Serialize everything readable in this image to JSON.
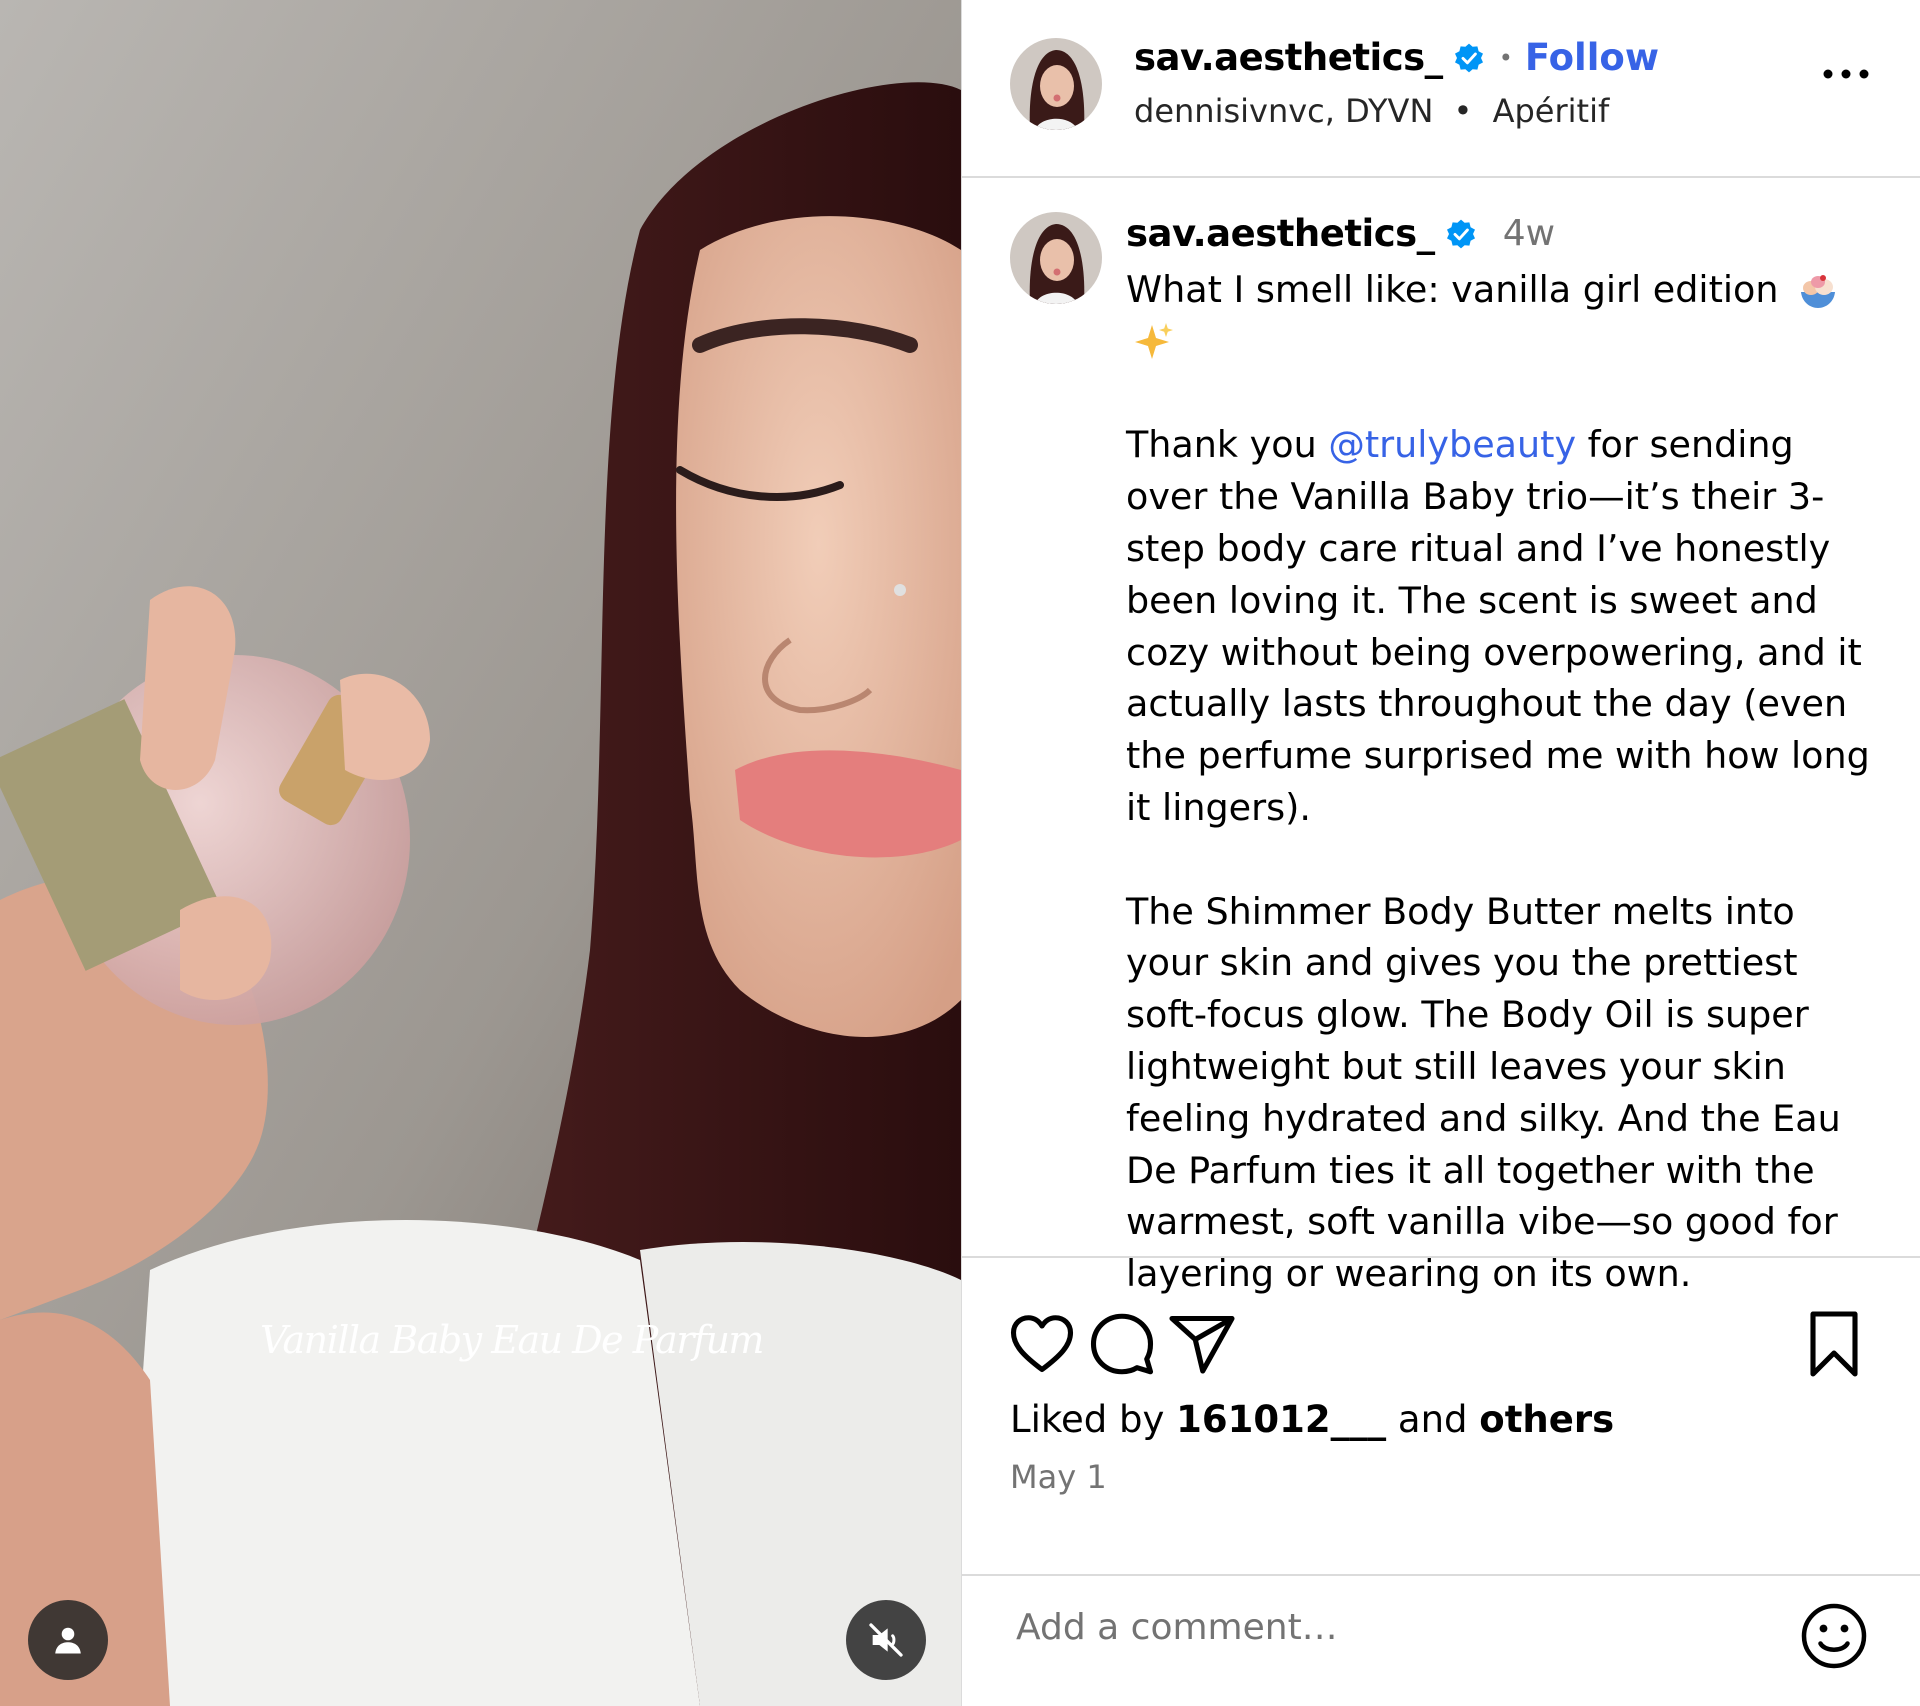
{
  "post": {
    "media": {
      "overlay_text": "Vanilla Baby Eau De Parfum",
      "tag_icon": "person-icon",
      "mute_icon": "speaker-muted-icon"
    },
    "header": {
      "username": "sav.aesthetics_",
      "verified": true,
      "separator": "•",
      "follow_label": "Follow",
      "audio_artists": "dennisivnvc, DYVN",
      "audio_separator": "•",
      "audio_title": "Apéritif",
      "more_icon": "more-horizontal-icon"
    },
    "caption": {
      "username": "sav.aesthetics_",
      "time": "4w",
      "first_line": "What I smell like: vanilla girl edition",
      "first_line_emojis": [
        "ice-cream-bowl-emoji",
        "sparkles-emoji"
      ],
      "para1_before": "Thank you ",
      "para1_mention": "@trulybeauty",
      "para1_after": " for sending over the Vanilla Baby trio—it’s their 3-step body care ritual and I’ve honestly been loving it. The scent is sweet and cozy without being overpowering, and it actually lasts throughout the day (even the perfume surprised me with how long it lingers).",
      "para2": "The Shimmer Body Butter melts into your skin and gives you the prettiest soft-focus glow. The Body Oil is super lightweight but still leaves your skin feeling hydrated and silky. And the Eau De Parfum ties it all together with the warmest, soft vanilla vibe—so good for layering or wearing on its own."
    },
    "actions": {
      "icons": [
        "heart-icon",
        "comment-icon",
        "share-icon",
        "bookmark-icon"
      ],
      "liked_by_prefix": "Liked by ",
      "liked_by_user": "161012___",
      "liked_by_mid": " and ",
      "liked_by_others": "others",
      "date": "May 1"
    },
    "comment": {
      "placeholder": "Add a comment…",
      "emoji_icon": "smiley-icon"
    }
  },
  "colors": {
    "link_blue": "#3763e6",
    "verified_blue": "#0095f6",
    "secondary_text": "#737373",
    "divider": "#dbdbdb"
  }
}
